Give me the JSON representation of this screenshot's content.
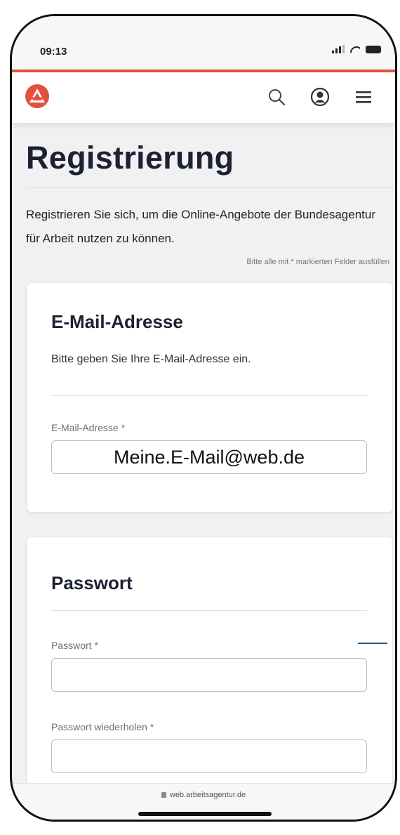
{
  "status_bar": {
    "time": "09:13"
  },
  "header": {
    "logo": "agentur-logo-icon",
    "icons": [
      "search-icon",
      "user-icon",
      "menu-icon"
    ],
    "accent_color": "#e2513c"
  },
  "page": {
    "title": "Registrierung",
    "intro": "Registrieren Sie sich, um die Online-Angebote der Bundesagentur für Arbeit nutzen zu können.",
    "required_hint": "Bitte alle mit * markierten Felder ausfüllen"
  },
  "email_section": {
    "title": "E-Mail-Adresse",
    "description": "Bitte geben Sie Ihre E-Mail-Adresse ein.",
    "field_label": "E-Mail-Adresse *",
    "field_value": "Meine.E-Mail@web.de"
  },
  "password_section": {
    "title": "Passwort",
    "password_label": "Passwort *",
    "password_value": "",
    "repeat_label": "Passwort wiederholen *",
    "repeat_value": ""
  },
  "browser": {
    "url": "web.arbeitsagentur.de"
  }
}
